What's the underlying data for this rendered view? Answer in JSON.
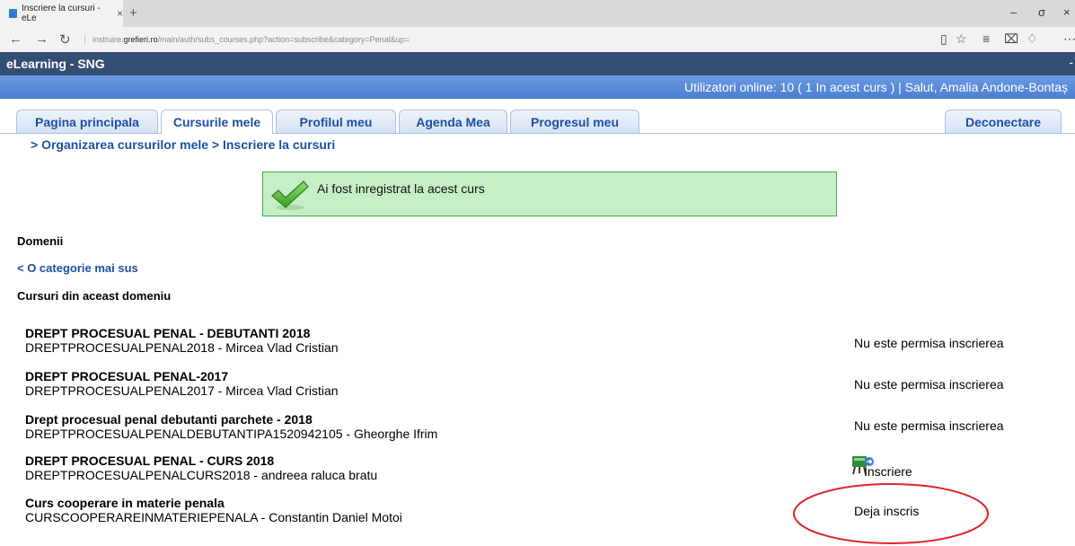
{
  "browser": {
    "tab_title": "Inscriere la cursuri - eLe",
    "tab_close": "×",
    "new_tab": "+",
    "url_prefix": "instruire.",
    "url_domain": "grefieri.ro",
    "url_rest": "/main/auth/subs_courses.php?action=subscribe&category=Penal&up=",
    "min_glyph": "–",
    "max_glyph": "σ",
    "close_glyph": "×",
    "back_glyph": "←",
    "forward_glyph": "→",
    "refresh_glyph": "↻",
    "reading_glyph": "▯",
    "favorite_glyph": "☆",
    "hub_glyph": "≡",
    "note_glyph": "⌧",
    "share_glyph": "♢",
    "more_glyph": "⋯"
  },
  "site": {
    "title": "eLearning - SNG",
    "right_mark": "-",
    "info": "Utilizatori online:  10  ( 1 In acest curs  ) | Salut, Amalia Andone-Bontaș"
  },
  "nav": {
    "tabs": [
      "Pagina principala",
      "Cursurile mele",
      "Profilul meu",
      "Agenda Mea",
      "Progresul meu"
    ],
    "active_tab": "Cursurile mele",
    "logout": "Deconectare"
  },
  "breadcrumb": "> Organizarea cursurilor mele > Inscriere la cursuri",
  "confirmation": {
    "message": "Ai fost inregistrat la acest curs",
    "icon": "checkmark-icon"
  },
  "content": {
    "domains_heading": "Domenii",
    "back_link": "< O categorie mai sus",
    "courses_heading": "Cursuri din aceast domeniu",
    "courses": [
      {
        "title": "DREPT PROCESUAL PENAL - DEBUTANTI 2018",
        "meta": "DREPTPROCESUALPENAL2018 - Mircea Vlad Cristian",
        "status": "Nu este permisa inscrierea"
      },
      {
        "title": "DREPT PROCESUAL PENAL-2017",
        "meta": "DREPTPROCESUALPENAL2017 - Mircea Vlad Cristian",
        "status": "Nu este permisa inscrierea"
      },
      {
        "title": "Drept procesual penal debutanti parchete - 2018",
        "meta": "DREPTPROCESUALPENALDEBUTANTIPA1520942105 - Gheorghe Ifrim",
        "status": "Nu este permisa inscrierea"
      },
      {
        "title": "DREPT PROCESUAL PENAL - CURS 2018",
        "meta": "DREPTPROCESUALPENALCURS2018 - andreea raluca bratu",
        "status": "Inscriere"
      },
      {
        "title": "Curs cooperare in materie penala",
        "meta": "CURSCOOPERAREINMATERIEPENALA - Constantin Daniel Motoi",
        "status": "Deja inscris"
      }
    ]
  },
  "colors": {
    "site_bar": "#344e73",
    "info_bar": "#5b8dd9",
    "link": "#1e50a2",
    "confirm_bg": "#c6efc5",
    "confirm_border": "#3fae49",
    "annotation": "#e0242b"
  }
}
